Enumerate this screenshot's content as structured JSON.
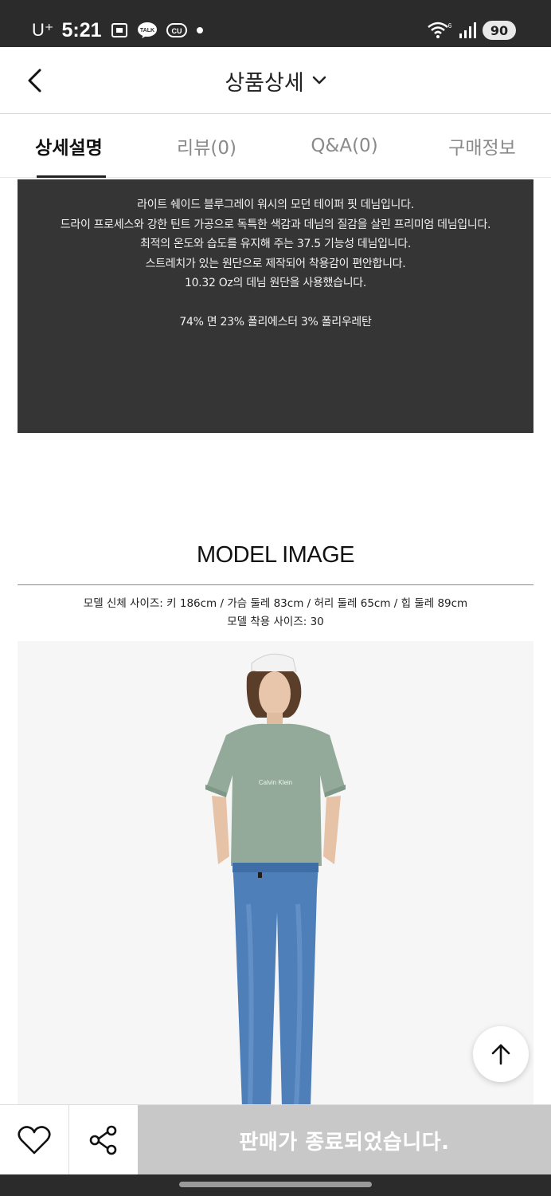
{
  "status_bar": {
    "carrier": "U⁺",
    "time": "5:21",
    "notification_icons": [
      "screenshot-icon",
      "kakaotalk-icon",
      "cu-icon",
      "dot-icon"
    ],
    "battery": "90"
  },
  "header": {
    "title": "상품상세",
    "back_icon": "chevron-left-icon",
    "dropdown_icon": "chevron-down-icon"
  },
  "tabs": [
    {
      "label": "상세설명",
      "active": true
    },
    {
      "label": "리뷰(0)",
      "active": false
    },
    {
      "label": "Q&A(0)",
      "active": false
    },
    {
      "label": "구매정보",
      "active": false
    }
  ],
  "description": {
    "lines": [
      "라이트 쉐이드 블루그레이 워시의 모던 테이퍼 핏 데님입니다.",
      "드라이 프로세스와 강한 틴트 가공으로 독특한 색감과 데님의 질감을 살린 프리미엄 데님입니다.",
      "최적의 온도와 습도를 유지해 주는 37.5 기능성 데님입니다.",
      "스트레치가 있는 원단으로 제작되어 착용감이 편안합니다.",
      "10.32 Oz의 데님 원단을 사용했습니다."
    ],
    "composition": "74% 면 23% 폴리에스터 3% 폴리우레탄"
  },
  "model_section": {
    "title": "MODEL IMAGE",
    "body_size": "모델 신체 사이즈: 키 186cm / 가슴 둘레 83cm / 허리 둘레 65cm / 힙 둘레 89cm",
    "wear_size": "모델 착용 사이즈:  30",
    "shirt_logo": "Calvin Klein"
  },
  "actions": {
    "scroll_top_icon": "arrow-up-icon",
    "like_icon": "heart-icon",
    "share_icon": "share-icon",
    "soldout_label": "판매가 종료되었습니다."
  },
  "colors": {
    "status_bar_bg": "#2b2b2b",
    "desc_bg": "#353535",
    "soldout_bg": "#c8c8c8",
    "shirt": "#93aa9b",
    "jeans": "#4f7fb8"
  }
}
